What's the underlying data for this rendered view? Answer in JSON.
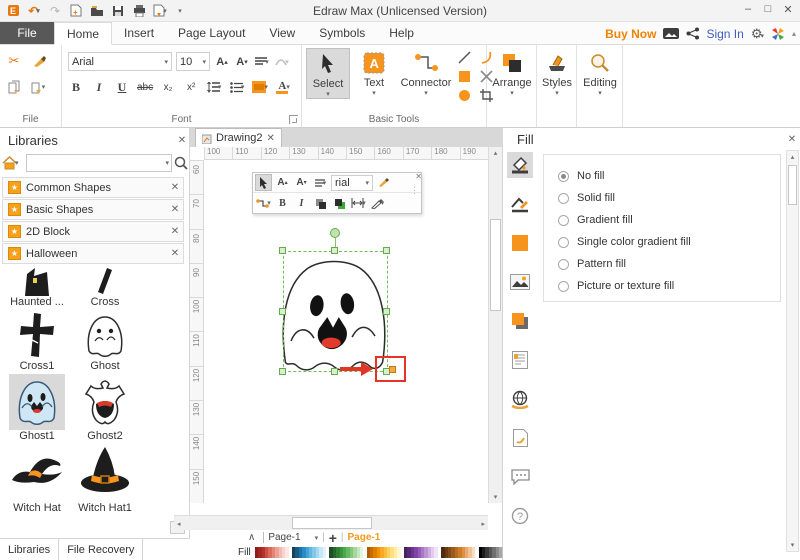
{
  "titlebar": {
    "title": "Edraw Max (Unlicensed Version)"
  },
  "menubar": {
    "tabs": [
      "File",
      "Home",
      "Insert",
      "Page Layout",
      "View",
      "Symbols",
      "Help"
    ],
    "buy_now": "Buy Now",
    "sign_in": "Sign In"
  },
  "ribbon": {
    "group_labels": {
      "file": "File",
      "font": "Font",
      "basic_tools": "Basic Tools"
    },
    "font_name": "Arial",
    "font_size": "10",
    "bold": "B",
    "italic": "I",
    "underline": "U",
    "strike": "abc",
    "subscript": "x₂",
    "superscript": "x²",
    "grow_font": "A",
    "shrink_font": "A",
    "font_color": "A",
    "select": "Select",
    "text": "Text",
    "connector": "Connector",
    "arrange": "Arrange",
    "styles": "Styles",
    "editing": "Editing"
  },
  "libraries": {
    "title": "Libraries",
    "sections": [
      {
        "label": "Common Shapes"
      },
      {
        "label": "Basic Shapes"
      },
      {
        "label": "2D Block"
      },
      {
        "label": "Halloween"
      }
    ],
    "shapes": [
      {
        "label": "Haunted ..."
      },
      {
        "label": "Cross"
      },
      {
        "label": "Cross1"
      },
      {
        "label": "Ghost"
      },
      {
        "label": "Ghost1",
        "selected": true
      },
      {
        "label": "Ghost2"
      },
      {
        "label": "Witch Hat"
      },
      {
        "label": "Witch Hat1"
      }
    ],
    "bottom_tabs": {
      "libraries": "Libraries",
      "file_recovery": "File Recovery"
    }
  },
  "canvas": {
    "tab": "Drawing2",
    "ruler_h": [
      "100",
      "110",
      "120",
      "130",
      "140",
      "150",
      "160",
      "170",
      "180",
      "190"
    ],
    "ruler_v": [
      "60",
      "70",
      "80",
      "90",
      "100",
      "110",
      "120",
      "130",
      "140",
      "150"
    ],
    "mini_toolbar": {
      "font_display": "rial",
      "bold": "B",
      "italic": "I"
    },
    "page_bar": {
      "page_tab": "Page-1",
      "active_page": "Page-1"
    }
  },
  "fill_panel": {
    "title": "Fill",
    "options": [
      "No fill",
      "Solid fill",
      "Gradient fill",
      "Single color gradient fill",
      "Pattern fill",
      "Picture or texture fill"
    ],
    "selected": "No fill"
  },
  "palette": {
    "label": "Fill",
    "colors": [
      "#8c1d18",
      "#a22622",
      "#b7312b",
      "#c94f44",
      "#d96a5e",
      "#e48579",
      "#eda096",
      "#f3bab2",
      "#f8d3cd",
      "#fbe7e3",
      "#ffffff",
      "#14405c",
      "#175a82",
      "#1b74a8",
      "#2a8cc2",
      "#45a3d4",
      "#62b6e0",
      "#83c8ea",
      "#a5d8f1",
      "#c6e7f7",
      "#e2f3fb",
      "#ffffff",
      "#1f4f24",
      "#27662b",
      "#2f7e33",
      "#3a963b",
      "#4ca94a",
      "#66b960",
      "#84c87c",
      "#a4d79b",
      "#c4e6bd",
      "#e2f3de",
      "#ffffff",
      "#b25a00",
      "#c96c00",
      "#e07e00",
      "#f29200",
      "#f9a825",
      "#fbbc3e",
      "#fdd05a",
      "#fee07e",
      "#ffeca6",
      "#fff6cf",
      "#ffffff",
      "#44215f",
      "#572b77",
      "#6b368f",
      "#8044a6",
      "#945cb6",
      "#a878c5",
      "#bc94d4",
      "#cfb0e2",
      "#e1cbee",
      "#f0e3f7",
      "#ffffff",
      "#4f2a10",
      "#693a14",
      "#824a18",
      "#9c5a1c",
      "#b56b20",
      "#ce7c24",
      "#dc9147",
      "#e7a96e",
      "#f0c295",
      "#f8dcc0",
      "#ffffff",
      "#000000",
      "#1c1c1c",
      "#383838",
      "#545454",
      "#707070",
      "#8c8c8c",
      "#a8a8a8",
      "#c4c4c4",
      "#e0e0e0",
      "#f4f4f4"
    ]
  },
  "glyphs": {
    "close": "✕",
    "dropdown": "▾",
    "collapse": "▴",
    "minimize": "–",
    "maximize": "□",
    "undo": "↶",
    "redo": "↷",
    "cut": "✂",
    "plus": "+",
    "chevron_up": "∧",
    "question": "?",
    "grip": "⋮",
    "pipe": "|",
    "arrow_left": "◂",
    "arrow_right": "▸",
    "arrow_up": "▴",
    "arrow_down": "▾"
  },
  "colors": {
    "accent": "#f7941e",
    "selection_green": "#76bb55",
    "alert_red": "#e43425",
    "signin_blue": "#3f5ebe",
    "buy_orange": "#f08200"
  }
}
